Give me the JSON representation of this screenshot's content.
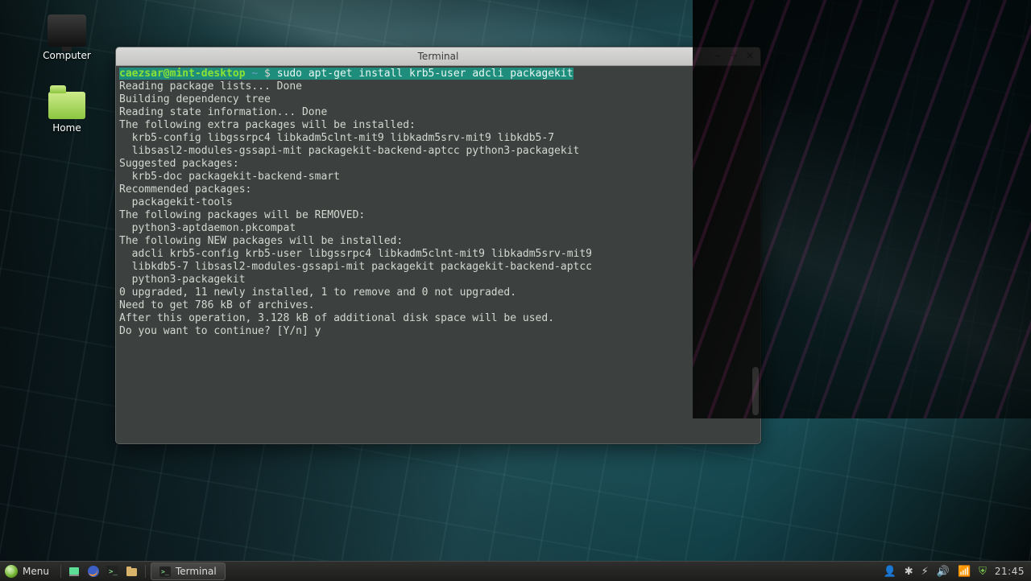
{
  "desktop": {
    "icons": {
      "computer": "Computer",
      "home": "Home"
    }
  },
  "window": {
    "title": "Terminal",
    "controls": {
      "min": "–",
      "max": "+",
      "close": "×"
    }
  },
  "terminal": {
    "prompt": {
      "userhost": "caezsar@mint-desktop",
      "sep1": " ",
      "path": "~",
      "sep2": " $ ",
      "command": "sudo apt-get install krb5-user adcli packagekit"
    },
    "lines": [
      "Reading package lists... Done",
      "Building dependency tree",
      "Reading state information... Done",
      "The following extra packages will be installed:",
      "  krb5-config libgssrpc4 libkadm5clnt-mit9 libkadm5srv-mit9 libkdb5-7",
      "  libsasl2-modules-gssapi-mit packagekit-backend-aptcc python3-packagekit",
      "Suggested packages:",
      "  krb5-doc packagekit-backend-smart",
      "Recommended packages:",
      "  packagekit-tools",
      "The following packages will be REMOVED:",
      "  python3-aptdaemon.pkcompat",
      "The following NEW packages will be installed:",
      "  adcli krb5-config krb5-user libgssrpc4 libkadm5clnt-mit9 libkadm5srv-mit9",
      "  libkdb5-7 libsasl2-modules-gssapi-mit packagekit packagekit-backend-aptcc",
      "  python3-packagekit",
      "0 upgraded, 11 newly installed, 1 to remove and 0 not upgraded.",
      "Need to get 786 kB of archives.",
      "After this operation, 3.128 kB of additional disk space will be used.",
      "Do you want to continue? [Y/n] y"
    ]
  },
  "taskbar": {
    "menu_label": "Menu",
    "quicklaunch": {
      "showdesktop": "show-desktop-icon",
      "firefox": "firefox-icon",
      "terminal": "terminal-icon",
      "files": "files-icon"
    },
    "task": {
      "label": "Terminal"
    },
    "tray": {
      "user": "user-icon",
      "bluetooth": "bluetooth-icon",
      "battery": "battery-icon",
      "volume": "volume-icon",
      "network": "network-icon",
      "shield": "shield-icon"
    },
    "clock": "21:45"
  },
  "colors": {
    "prompt_user": "#8ae234",
    "cmd_highlight": "#1f8d7c",
    "terminal_bg": "#3c4140",
    "terminal_fg": "#d4d7cf"
  }
}
